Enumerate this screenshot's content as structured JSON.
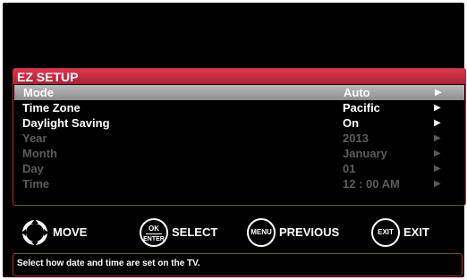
{
  "menu": {
    "title": "EZ SETUP",
    "arrow": "▶",
    "rows": [
      {
        "label": "Mode",
        "value": "Auto"
      },
      {
        "label": "Time Zone",
        "value": "Pacific"
      },
      {
        "label": "Daylight Saving",
        "value": "On"
      },
      {
        "label": "Year",
        "value": "2013"
      },
      {
        "label": "Month",
        "value": "January"
      },
      {
        "label": "Day",
        "value": "01"
      },
      {
        "label": "Time",
        "value": "12 : 00 AM"
      }
    ],
    "selected_row": "Mode",
    "disabled_rows": [
      "Year",
      "Month",
      "Day",
      "Time"
    ]
  },
  "legend": {
    "move": {
      "label": "MOVE",
      "icon": "dpad-icon"
    },
    "select": {
      "label": "SELECT",
      "button_top": "OK",
      "button_bottom": "ENTER"
    },
    "previous": {
      "label": "PREVIOUS",
      "button": "MENU"
    },
    "exit": {
      "label": "EXIT",
      "button": "EXIT"
    }
  },
  "help": {
    "text": "Select how date and time are set on the TV."
  },
  "colors": {
    "accent": "#c8263a",
    "selected_row": "#a6a6a6",
    "disabled_text": "#5c5c5c",
    "background": "#000000"
  }
}
